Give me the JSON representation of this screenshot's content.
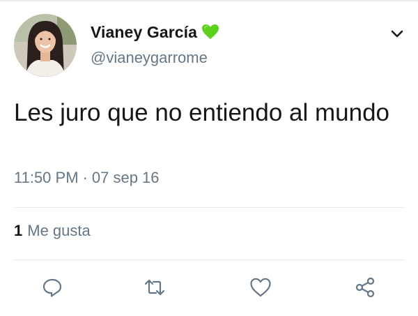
{
  "tweet": {
    "author": {
      "display_name": "Vianey García",
      "handle": "@vianeygarrome",
      "avatar_icon": "profile-photo",
      "badge_icon": "green-heart-emoji"
    },
    "text": "Les juro que no entiendo al mundo",
    "time": "11:50 PM",
    "separator": "·",
    "date": "07 sep 16",
    "likes": {
      "count": "1",
      "label": "Me gusta"
    },
    "menu_icon": "chevron-down-icon",
    "actions": [
      {
        "name": "reply",
        "icon": "reply-icon"
      },
      {
        "name": "retweet",
        "icon": "retweet-icon"
      },
      {
        "name": "like",
        "icon": "heart-icon"
      },
      {
        "name": "share",
        "icon": "share-icon"
      }
    ]
  },
  "colors": {
    "text_primary": "#14171a",
    "text_secondary": "#657786",
    "divider": "#e1e8ed",
    "heart_green": "#5bd11c",
    "icon_gray": "#657786"
  }
}
